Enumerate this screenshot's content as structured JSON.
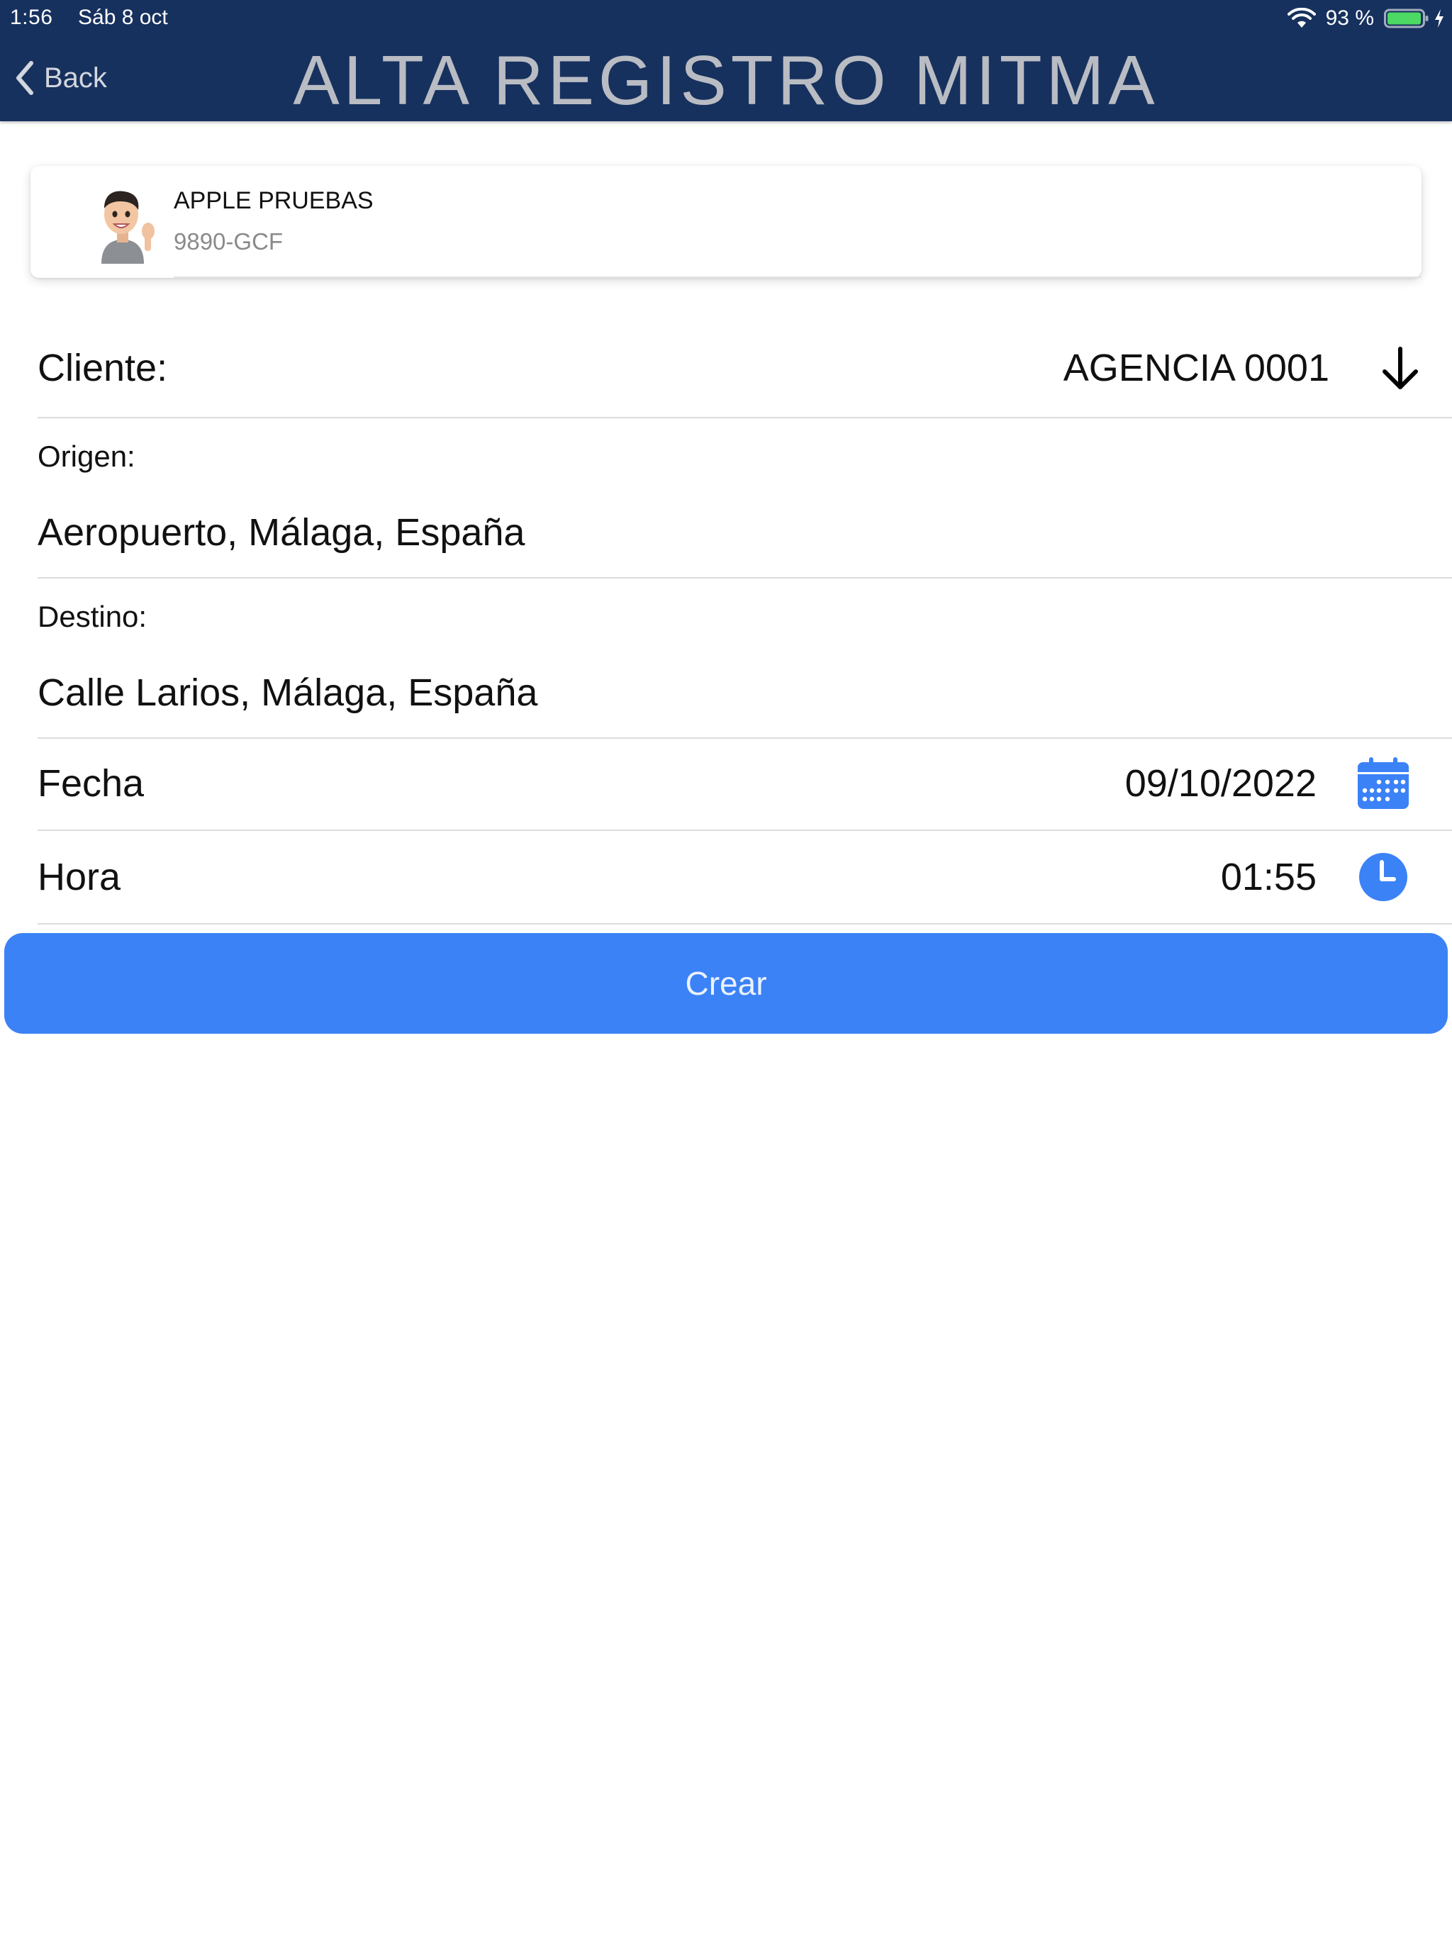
{
  "status_bar": {
    "time": "1:56",
    "date": "Sáb 8 oct",
    "battery": "93 %"
  },
  "nav": {
    "back_label": "Back",
    "title": "ALTA REGISTRO MITMA"
  },
  "driver": {
    "name": "APPLE PRUEBAS",
    "plate": "9890-GCF"
  },
  "form": {
    "client_label": "Cliente:",
    "client_value": "AGENCIA 0001",
    "origin_label": "Origen:",
    "origin_value": "Aeropuerto, Málaga, España",
    "destination_label": "Destino:",
    "destination_value": "Calle Larios, Málaga, España",
    "date_label": "Fecha",
    "date_value": "09/10/2022",
    "time_label": "Hora",
    "time_value": "01:55"
  },
  "actions": {
    "create_label": "Crear"
  },
  "colors": {
    "header_bg": "#17315e",
    "accent": "#3b82f6",
    "battery_fill": "#4cd964"
  },
  "icons": {
    "back": "chevron-left-icon",
    "wifi": "wifi-icon",
    "battery": "battery-icon",
    "client_picker": "arrow-down-icon",
    "date_picker": "calendar-icon",
    "time_picker": "clock-icon"
  }
}
